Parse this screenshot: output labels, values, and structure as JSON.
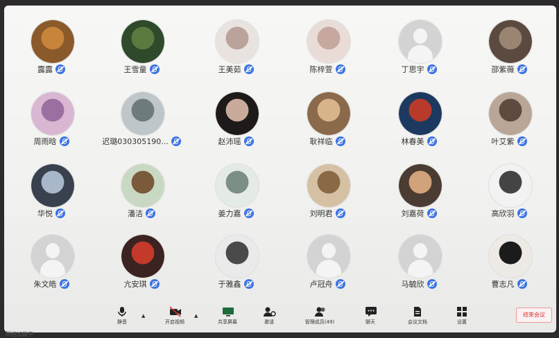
{
  "participants": [
    {
      "name": "露露",
      "avatar": "owl-avatar"
    },
    {
      "name": "王雪童",
      "avatar": "forest-avatar"
    },
    {
      "name": "王美茹",
      "avatar": "anime-girl-avatar"
    },
    {
      "name": "陈梓萱",
      "avatar": "sketch-avatar"
    },
    {
      "name": "丁思宇",
      "avatar": "default-avatar"
    },
    {
      "name": "邵紫薇",
      "avatar": "photo-avatar"
    },
    {
      "name": "周雨晗",
      "avatar": "pink-girl-avatar"
    },
    {
      "name": "迟璐030305190...",
      "avatar": "person-avatar"
    },
    {
      "name": "赵沛瑶",
      "avatar": "portrait-avatar"
    },
    {
      "name": "耿祥临",
      "avatar": "cat-avatar"
    },
    {
      "name": "林春美",
      "avatar": "poster-avatar"
    },
    {
      "name": "叶艾紫",
      "avatar": "vintage-avatar"
    },
    {
      "name": "华悦",
      "avatar": "anime-boy-avatar"
    },
    {
      "name": "潘洁",
      "avatar": "cartoon-avatar"
    },
    {
      "name": "姜力嘉",
      "avatar": "anime-teen-avatar"
    },
    {
      "name": "刘明君",
      "avatar": "cats-avatar"
    },
    {
      "name": "刘嘉荷",
      "avatar": "character-avatar"
    },
    {
      "name": "高欣羽",
      "avatar": "doodle-avatar"
    },
    {
      "name": "朱文皓",
      "avatar": "default-avatar"
    },
    {
      "name": "亢安琪",
      "avatar": "woman-avatar"
    },
    {
      "name": "于雅鑫",
      "avatar": "chibi-avatar"
    },
    {
      "name": "卢冠舟",
      "avatar": "default-avatar"
    },
    {
      "name": "马毓欣",
      "avatar": "default-avatar"
    },
    {
      "name": "曹志凡",
      "avatar": "silhouette-photo-avatar"
    }
  ],
  "toolbar": {
    "mute": "静音",
    "video": "开启视频",
    "share": "共享屏幕",
    "invite": "邀请",
    "members": "管理成员(49)",
    "chat": "聊天",
    "docs": "会议文档",
    "settings": "设置",
    "end": "结束会议"
  },
  "status_text": "网络加载中"
}
